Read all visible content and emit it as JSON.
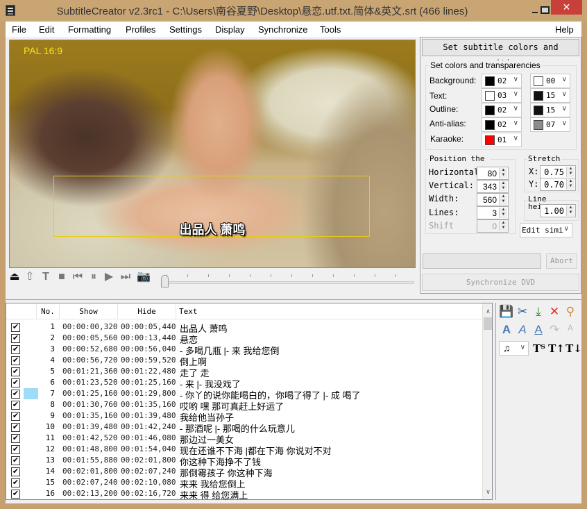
{
  "window": {
    "title": "SubtitleCreator v2.3rc1 - C:\\Users\\南谷夏野\\Desktop\\悬恋.utf.txt.简体&英文.srt (466 lines)",
    "close_glyph": "✕"
  },
  "menu": [
    "File",
    "Edit",
    "Formatting",
    "Profiles",
    "Settings",
    "Display",
    "Synchronize",
    "Tools"
  ],
  "menu_help": "Help",
  "video": {
    "format_badge": "PAL 16:9",
    "subtitle_text": "出品人 萧鸣"
  },
  "player": {
    "buttons": [
      {
        "name": "eject",
        "glyph": "⏏"
      },
      {
        "name": "home",
        "glyph": "⇧"
      },
      {
        "name": "text",
        "glyph": "T"
      },
      {
        "name": "stop",
        "glyph": "■"
      },
      {
        "name": "previous",
        "glyph": "⏮"
      },
      {
        "name": "pause",
        "glyph": "⏸"
      },
      {
        "name": "play",
        "glyph": "▶"
      },
      {
        "name": "next",
        "glyph": "⏭"
      },
      {
        "name": "snapshot",
        "glyph": "📷"
      }
    ],
    "position_fraction": 0.0
  },
  "right_panel": {
    "set_colors_button": "Set subtitle colors and position",
    "colors_group": "Set colors and transparencies",
    "color_rows": [
      {
        "label": "Background:",
        "left": {
          "swatch": "#000000",
          "value": "02"
        },
        "right": {
          "swatch": "#ffffff",
          "value": "00"
        }
      },
      {
        "label": "Text:",
        "left": {
          "swatch": "#ffffff",
          "value": "03"
        },
        "right": {
          "swatch": "#111111",
          "value": "15"
        }
      },
      {
        "label": "Outline:",
        "left": {
          "swatch": "#000000",
          "value": "02"
        },
        "right": {
          "swatch": "#111111",
          "value": "15"
        }
      },
      {
        "label": "Anti-alias:",
        "left": {
          "swatch": "#000000",
          "value": "02"
        },
        "right": {
          "swatch": "#8c8c8c",
          "value": "07"
        }
      },
      {
        "label": "Karaoke:",
        "left": {
          "swatch": "#ff0000",
          "value": "01"
        }
      }
    ],
    "position_group": "Position the subtitle",
    "position_fields": [
      {
        "label": "Horizontal",
        "value": "80"
      },
      {
        "label": "Vertical:",
        "value": "343"
      },
      {
        "label": "Width:",
        "value": "560"
      },
      {
        "label": "Lines:",
        "value": "3"
      },
      {
        "label": "Shift",
        "value": "0",
        "disabled": true
      }
    ],
    "stretch_group": "Stretch",
    "stretch_x_label": "X:",
    "stretch_x": "0.75",
    "stretch_y_label": "Y:",
    "stretch_y": "0.70",
    "line_height_group": "Line height",
    "line_height": "1.00",
    "edit_select": "Edit simi",
    "abort_button": "Abort",
    "sync_dvd_button": "Synchronize DVD"
  },
  "subtitle_list": {
    "columns": [
      "No.",
      "Show",
      "Hide",
      "Text"
    ],
    "rows": [
      {
        "checked": true,
        "no": "1",
        "show": "00:00:00,320",
        "hide": "00:00:05,440",
        "text": "出品人 萧鸣"
      },
      {
        "checked": true,
        "no": "2",
        "show": "00:00:05,560",
        "hide": "00:00:13,440",
        "text": "悬恋"
      },
      {
        "checked": true,
        "no": "3",
        "show": "00:00:52,680",
        "hide": "00:00:56,040",
        "text": "- 多喝几瓶 |- 来 我给您倒"
      },
      {
        "checked": true,
        "no": "4",
        "show": "00:00:56,720",
        "hide": "00:00:59,520",
        "text": "倒上啊"
      },
      {
        "checked": true,
        "no": "5",
        "show": "00:01:21,360",
        "hide": "00:01:22,480",
        "text": "走了 走"
      },
      {
        "checked": true,
        "no": "6",
        "show": "00:01:23,520",
        "hide": "00:01:25,160",
        "text": "- 来 |- 我没戏了"
      },
      {
        "checked": true,
        "no": "7",
        "show": "00:01:25,160",
        "hide": "00:01:29,800",
        "text": "- 你丫的说你能喝白的，你喝了得了 |- 成 喝了",
        "marked": true
      },
      {
        "checked": true,
        "no": "8",
        "show": "00:01:30,760",
        "hide": "00:01:35,160",
        "text": "哎哟 嘿 那可真赶上好运了"
      },
      {
        "checked": true,
        "no": "9",
        "show": "00:01:35,160",
        "hide": "00:01:39,480",
        "text": "我给他当孙子"
      },
      {
        "checked": true,
        "no": "10",
        "show": "00:01:39,480",
        "hide": "00:01:42,240",
        "text": "- 那酒呢 |- 那喝的什么玩意儿"
      },
      {
        "checked": true,
        "no": "11",
        "show": "00:01:42,520",
        "hide": "00:01:46,080",
        "text": "那边过一美女"
      },
      {
        "checked": true,
        "no": "12",
        "show": "00:01:48,800",
        "hide": "00:01:54,040",
        "text": "现在还谁不下海 |都在下海  你说对不对"
      },
      {
        "checked": true,
        "no": "13",
        "show": "00:01:55,880",
        "hide": "00:02:01,800",
        "text": "你这种下海挣不了钱"
      },
      {
        "checked": true,
        "no": "14",
        "show": "00:02:01,800",
        "hide": "00:02:07,240",
        "text": "那倒霉孩子  你这种下海"
      },
      {
        "checked": true,
        "no": "15",
        "show": "00:02:07,240",
        "hide": "00:02:10,080",
        "text": "来来 我给您倒上"
      },
      {
        "checked": true,
        "no": "16",
        "show": "00:02:13,200",
        "hide": "00:02:16,720",
        "text": "来来 得 给您满上"
      }
    ]
  },
  "toolbox": {
    "row1": [
      {
        "name": "save",
        "glyph": "💾",
        "color": "#4a5bb0"
      },
      {
        "name": "cut",
        "glyph": "✂",
        "color": "#2a5a9a"
      },
      {
        "name": "merge",
        "glyph": "⤓",
        "color": "#2e8b2e"
      },
      {
        "name": "delete",
        "glyph": "✕",
        "color": "#e03020"
      },
      {
        "name": "find",
        "glyph": "⚲",
        "color": "#d08a30"
      }
    ],
    "row2": [
      {
        "name": "bold",
        "glyph": "A",
        "color": "#4a78b8"
      },
      {
        "name": "italic",
        "glyph": "A",
        "color": "#4a78b8"
      },
      {
        "name": "underline",
        "glyph": "A",
        "color": "#4a78b8"
      },
      {
        "name": "redo",
        "glyph": "↷",
        "color": "#bbbbbb"
      },
      {
        "name": "replace",
        "glyph": "ᴬ",
        "color": "#bbbbbb"
      }
    ],
    "music_select": "♫",
    "row3": [
      {
        "name": "font-size",
        "glyph": "Tᵀ"
      },
      {
        "name": "move-up",
        "glyph": "T↑"
      },
      {
        "name": "move-down",
        "glyph": "T↓"
      }
    ]
  }
}
